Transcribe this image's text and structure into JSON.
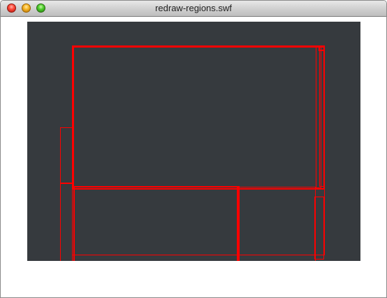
{
  "window": {
    "title": "redraw-regions.swf"
  },
  "titlebar": {
    "buttons": [
      "close",
      "minimize",
      "zoom"
    ]
  },
  "stage": {
    "background": "#363a3e",
    "region_color": "#ff0000"
  }
}
